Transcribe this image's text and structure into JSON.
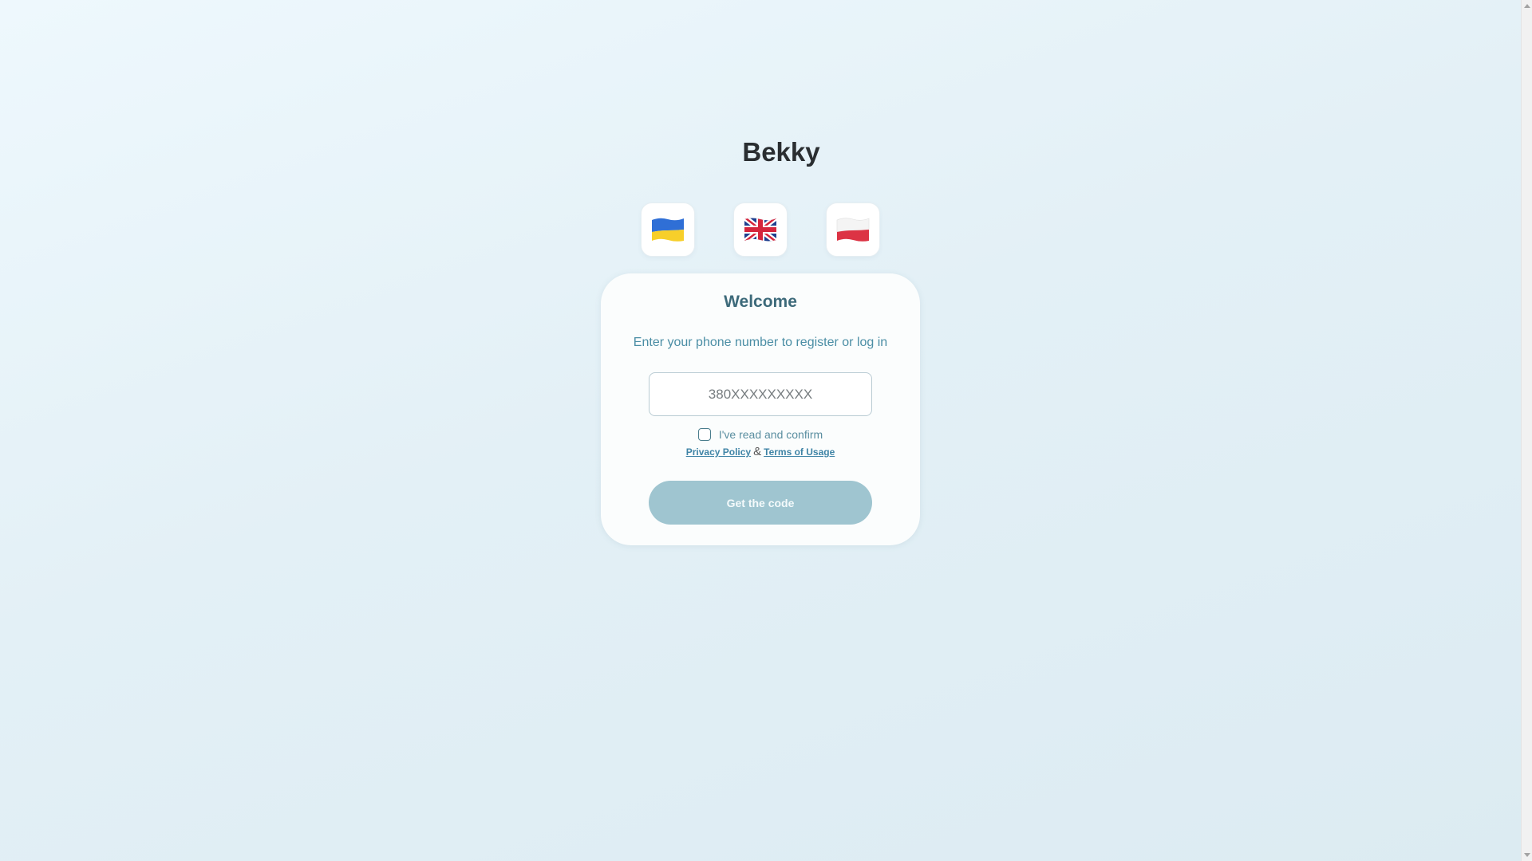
{
  "app": {
    "brand": "Bekky"
  },
  "languages": [
    {
      "code": "uk",
      "flag": "ukraine-flag-icon"
    },
    {
      "code": "en",
      "flag": "uk-flag-icon"
    },
    {
      "code": "pl",
      "flag": "poland-flag-icon"
    }
  ],
  "login": {
    "title": "Welcome",
    "subtitle": "Enter your phone number to register or log in",
    "phone_placeholder": "380XXXXXXXXX",
    "phone_value": "",
    "consent_text": "I've read and confirm",
    "consent_checked": false,
    "privacy_label": "Privacy Policy",
    "ampersand": "&",
    "terms_label": "Terms of Usage",
    "submit_label": "Get the code"
  },
  "colors": {
    "brand_text": "#2a2e31",
    "accent": "#4b8ea5",
    "button_disabled": "#9fc5d0",
    "link": "#3f84a6"
  }
}
